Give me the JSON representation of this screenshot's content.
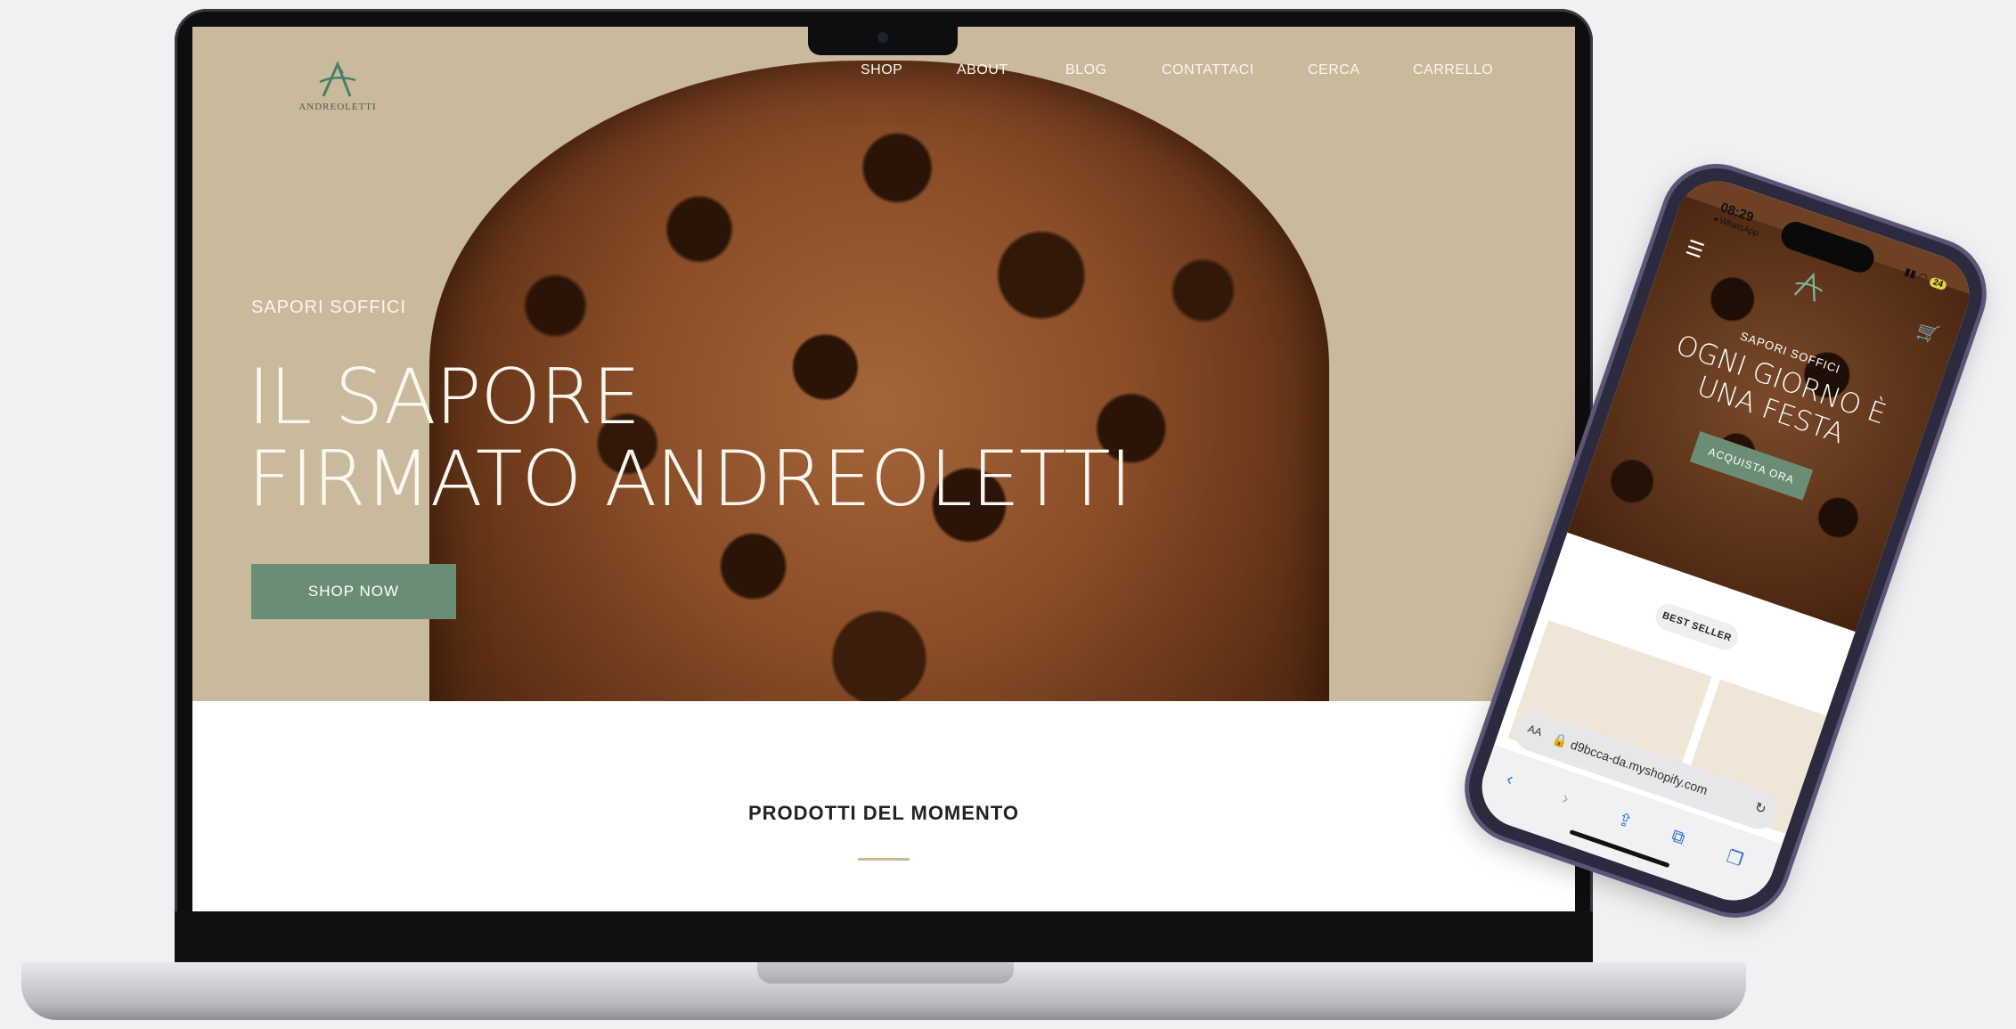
{
  "site": {
    "logo_text": "ANDREOLETTI",
    "nav": [
      "SHOP",
      "ABOUT",
      "BLOG",
      "CONTATTACI",
      "CERCA",
      "CARRELLO"
    ],
    "hero": {
      "eyebrow": "SAPORI SOFFICI",
      "title": "IL SAPORE\nFIRMATO ANDREOLETTI",
      "cta": "SHOP NOW"
    },
    "section_title": "PRODOTTI DEL MOMENTO"
  },
  "phone": {
    "status": {
      "time": "08:29",
      "back_app": "◂ WhatsApp",
      "battery": "24"
    },
    "hero": {
      "eyebrow": "SAPORI SOFFICI",
      "title": "OGNI GIORNO È\nUNA FESTA",
      "cta": "ACQUISTA ORA"
    },
    "badge": "BEST SELLER",
    "browser": {
      "aa": "AA",
      "url": "d9bcca-da.myshopify.com"
    }
  },
  "colors": {
    "hero_bg": "#c9b99d",
    "accent_green": "#6b8d74",
    "logo_green": "#4b7f67"
  },
  "icons": [
    "menu-icon",
    "cart-icon",
    "lock-icon",
    "reload-icon",
    "back-icon",
    "forward-icon",
    "share-icon",
    "bookmarks-icon",
    "tabs-icon"
  ]
}
